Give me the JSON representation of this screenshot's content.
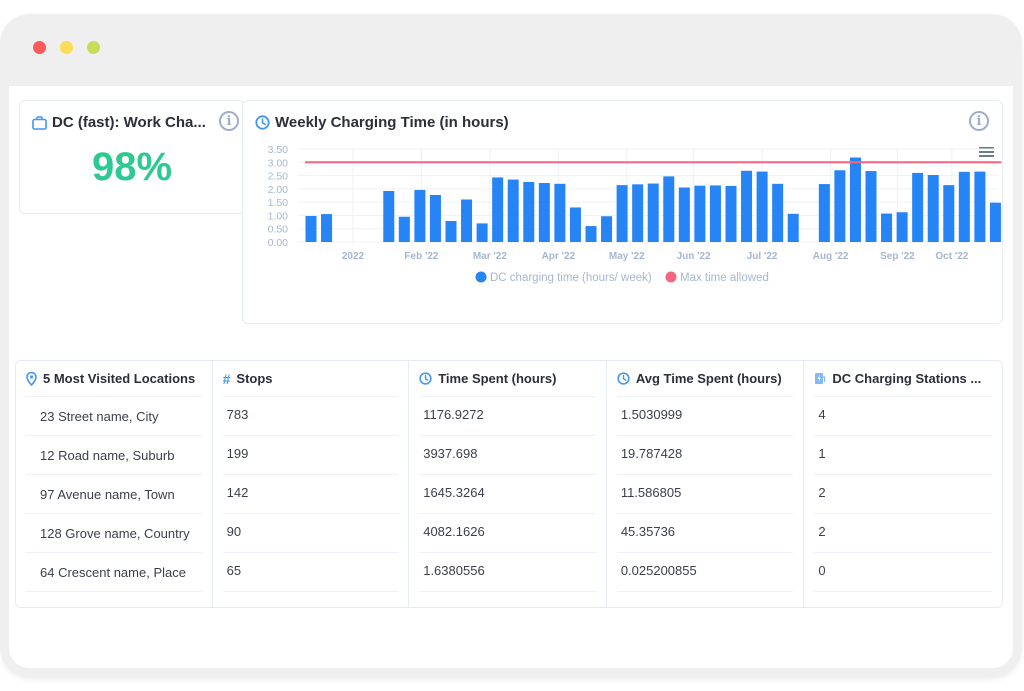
{
  "window": {
    "controls": [
      "close",
      "minimize",
      "maximize"
    ]
  },
  "kpi": {
    "title": "DC (fast): Work Cha...",
    "icon": "briefcase-icon",
    "value": "98%",
    "value_color": "#2ec990",
    "info_icon": "info-icon"
  },
  "chart_card": {
    "title": "Weekly Charging Time (in hours)",
    "icon": "clock-icon",
    "info_icon": "info-icon",
    "menu_icon": "hamburger-menu-icon"
  },
  "chart_data": {
    "type": "bar",
    "title": "Weekly Charging Time (in hours)",
    "xlabel": "",
    "ylabel": "",
    "ylim": [
      0,
      3.5
    ],
    "yticks": [
      "0.00",
      "0.50",
      "1.00",
      "1.50",
      "2.00",
      "2.50",
      "3.00",
      "3.50"
    ],
    "ytick_values": [
      0,
      0.5,
      1.0,
      1.5,
      2.0,
      2.5,
      3.0,
      3.5
    ],
    "xtick_labels": [
      "2022",
      "Feb '22",
      "Mar '22",
      "Apr '22",
      "May '22",
      "Jun '22",
      "Jul '22",
      "Aug '22",
      "Sep '22",
      "Oct '22"
    ],
    "xtick_week_index": [
      2.7,
      7.1,
      11.5,
      15.9,
      20.3,
      24.6,
      29.0,
      33.4,
      37.7,
      41.2
    ],
    "grid": true,
    "legend_position": "bottom-center",
    "weeks_total": 45,
    "series": [
      {
        "name": "DC charging time (hours/ week)",
        "color": "#2684f5",
        "type": "bar",
        "week_index": [
          0,
          1,
          5,
          6,
          7,
          8,
          9,
          10,
          11,
          12,
          13,
          14,
          15,
          16,
          17,
          18,
          19,
          20,
          21,
          22,
          23,
          24,
          25,
          26,
          27,
          28,
          29,
          30,
          31,
          33,
          34,
          35,
          36,
          37,
          38,
          39,
          40,
          41,
          42,
          43,
          44
        ],
        "values": [
          0.98,
          1.05,
          1.92,
          0.95,
          1.96,
          1.77,
          0.79,
          1.6,
          0.7,
          2.43,
          2.35,
          2.26,
          2.22,
          2.19,
          1.3,
          0.6,
          0.97,
          2.14,
          2.17,
          2.2,
          2.47,
          2.05,
          2.12,
          2.13,
          2.11,
          2.68,
          2.65,
          2.19,
          1.06,
          2.18,
          2.7,
          3.18,
          2.67,
          1.07,
          1.12,
          2.6,
          2.52,
          2.14,
          2.64,
          2.65,
          1.48
        ]
      },
      {
        "name": "Max time allowed",
        "color": "#f5657e",
        "type": "line",
        "value": 3.0
      }
    ]
  },
  "table": {
    "columns": [
      {
        "label": "5 Most Visited Locations",
        "icon": "map-pin-icon"
      },
      {
        "label": "Stops",
        "icon": "hash-icon"
      },
      {
        "label": "Time Spent (hours)",
        "icon": "clock-icon"
      },
      {
        "label": "Avg Time Spent (hours)",
        "icon": "clock-icon"
      },
      {
        "label": "DC Charging Stations ...",
        "icon": "charging-station-icon"
      }
    ],
    "rows": [
      [
        "23 Street name, City",
        "783",
        "1176.9272",
        "1.5030999",
        "4"
      ],
      [
        "12 Road name, Suburb",
        "199",
        "3937.698",
        "19.787428",
        "1"
      ],
      [
        "97 Avenue name, Town",
        "142",
        "1645.3264",
        "11.586805",
        "2"
      ],
      [
        "128 Grove name, Country",
        "90",
        "4082.1626",
        "45.35736",
        "2"
      ],
      [
        "64 Crescent name, Place",
        "65",
        "1.6380556",
        "0.025200855",
        "0"
      ]
    ]
  }
}
